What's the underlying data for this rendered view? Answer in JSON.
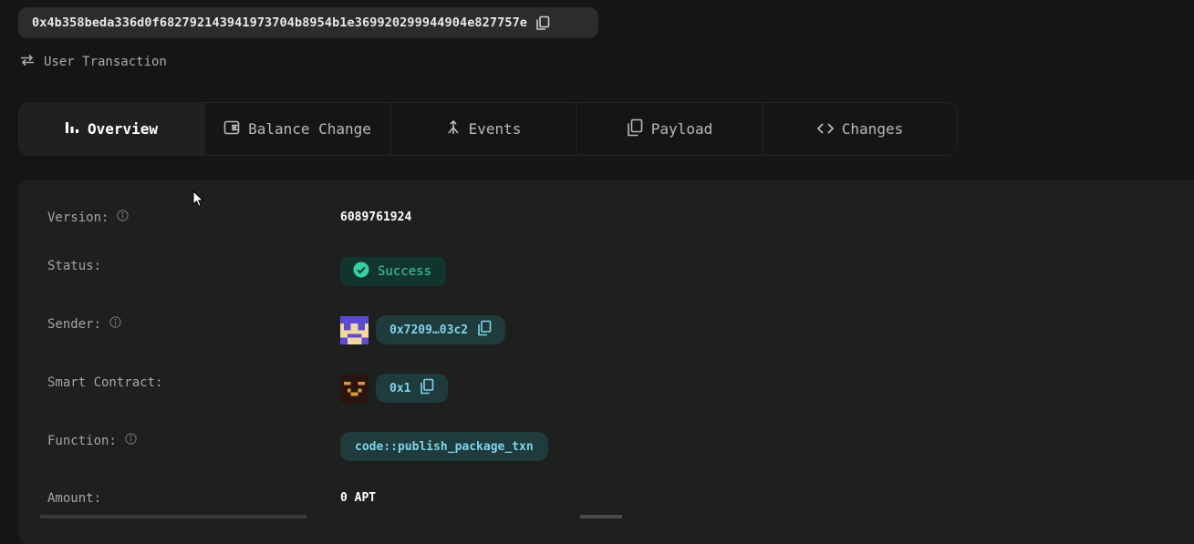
{
  "transaction": {
    "hash": "0x4b358beda336d0f68279214394197370 4b8954b1e369920299944904e827757e",
    "type": "User Transaction"
  },
  "tabs": [
    {
      "label": "Overview",
      "icon": "bar-chart-icon",
      "active": true
    },
    {
      "label": "Balance Change",
      "icon": "wallet-icon",
      "active": false
    },
    {
      "label": "Events",
      "icon": "merge-icon",
      "active": false
    },
    {
      "label": "Payload",
      "icon": "copy-icon",
      "active": false
    },
    {
      "label": "Changes",
      "icon": "code-icon",
      "active": false
    }
  ],
  "overview": {
    "version": {
      "label": "Version:",
      "value": "6089761924"
    },
    "status": {
      "label": "Status:",
      "value": "Success"
    },
    "sender": {
      "label": "Sender:",
      "value": "0x7209…03c2"
    },
    "smart_contract": {
      "label": "Smart Contract:",
      "value": "0x1"
    },
    "function": {
      "label": "Function:",
      "value": "code::publish_package_txn"
    },
    "amount": {
      "label": "Amount:",
      "value": "0 APT"
    }
  },
  "colors": {
    "background": "#141514",
    "panel": "#1e201f",
    "success": "#33d1a1",
    "address": "#7fd3ec"
  }
}
